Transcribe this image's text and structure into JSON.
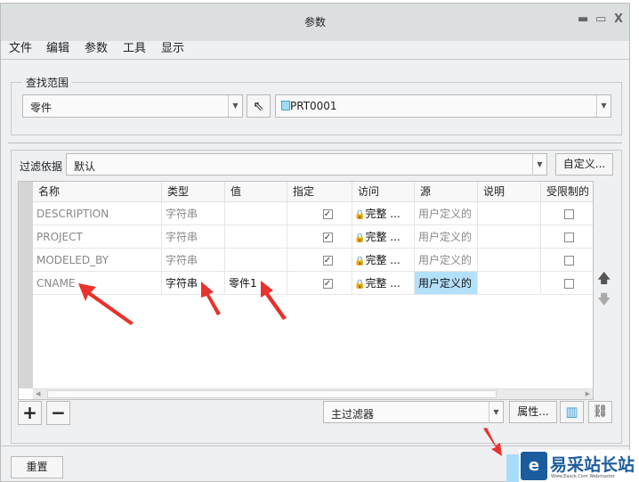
{
  "window": {
    "title": "参数",
    "minimize": "▬",
    "maximize": "▭",
    "close": "X"
  },
  "menu": [
    "文件",
    "编辑",
    "参数",
    "工具",
    "显示"
  ],
  "scope": {
    "label": "查找范围",
    "type": "零件",
    "model": "PRT0001"
  },
  "filter": {
    "label": "过滤依据",
    "value": "默认",
    "customize": "自定义..."
  },
  "table": {
    "columns": [
      "名称",
      "类型",
      "值",
      "指定",
      "访问",
      "源",
      "说明",
      "受限制的"
    ],
    "rows": [
      {
        "name": "DESCRIPTION",
        "type": "字符串",
        "value": "",
        "designated": true,
        "access": "完整",
        "source": "用户定义的",
        "description": "",
        "restricted": false
      },
      {
        "name": "PROJECT",
        "type": "字符串",
        "value": "",
        "designated": true,
        "access": "完整",
        "source": "用户定义的",
        "description": "",
        "restricted": false
      },
      {
        "name": "MODELED_BY",
        "type": "字符串",
        "value": "",
        "designated": true,
        "access": "完整",
        "source": "用户定义的",
        "description": "",
        "restricted": false
      },
      {
        "name": "CNAME",
        "type": "字符串",
        "value": "零件1",
        "designated": true,
        "access": "完整",
        "source": "用户定义的",
        "description": "",
        "restricted": false
      }
    ],
    "ellipsis": "..."
  },
  "bottom": {
    "filter": "主过滤器",
    "properties": "属性...",
    "reset": "重置"
  },
  "watermark": {
    "text": "易采站长站",
    "sub": "Www.Easck.Com Webmaster"
  },
  "colors": {
    "selected_cell": "#b3e0fb",
    "arrow": "#e8322b"
  }
}
